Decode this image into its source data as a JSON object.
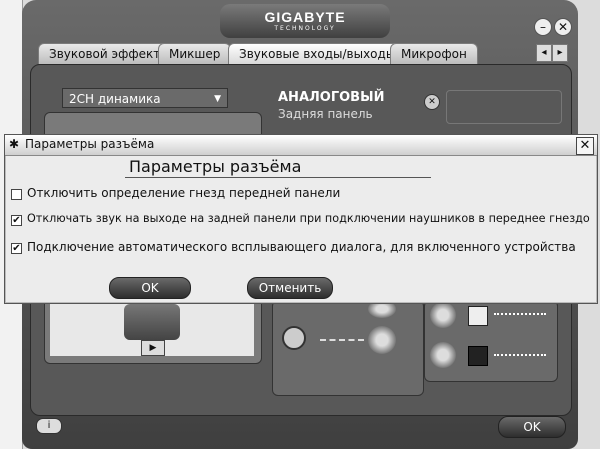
{
  "app": {
    "brand": "GIGABYTE",
    "brand_sub": "TECHNOLOGY",
    "tabs": [
      "Звуковой эффект",
      "Микшер",
      "Звуковые входы/выходы",
      "Микрофон"
    ],
    "speaker_select": "2CH динамика",
    "analog_title": "АНАЛОГОВЫЙ",
    "analog_sub": "Задняя панель",
    "ok_label": "OK",
    "info_label": "i"
  },
  "dialog": {
    "title": "Параметры разъёма",
    "heading": "Параметры разъёма",
    "options": [
      {
        "label": "Отключить определение гнезд передней панели",
        "checked": false
      },
      {
        "label": "Отключать звук на выходе на задней панели при подключении наушников в переднее гнездо",
        "checked": true
      },
      {
        "label": "Подключение автоматического всплывающего диалога, для включенного устройства",
        "checked": true
      }
    ],
    "ok_label": "OK",
    "cancel_label": "Отменить",
    "close_glyph": "✕"
  },
  "colors": {
    "skin_dark": "#3f3f3f",
    "panel": "#585858",
    "dialog_bg": "#ececec"
  }
}
